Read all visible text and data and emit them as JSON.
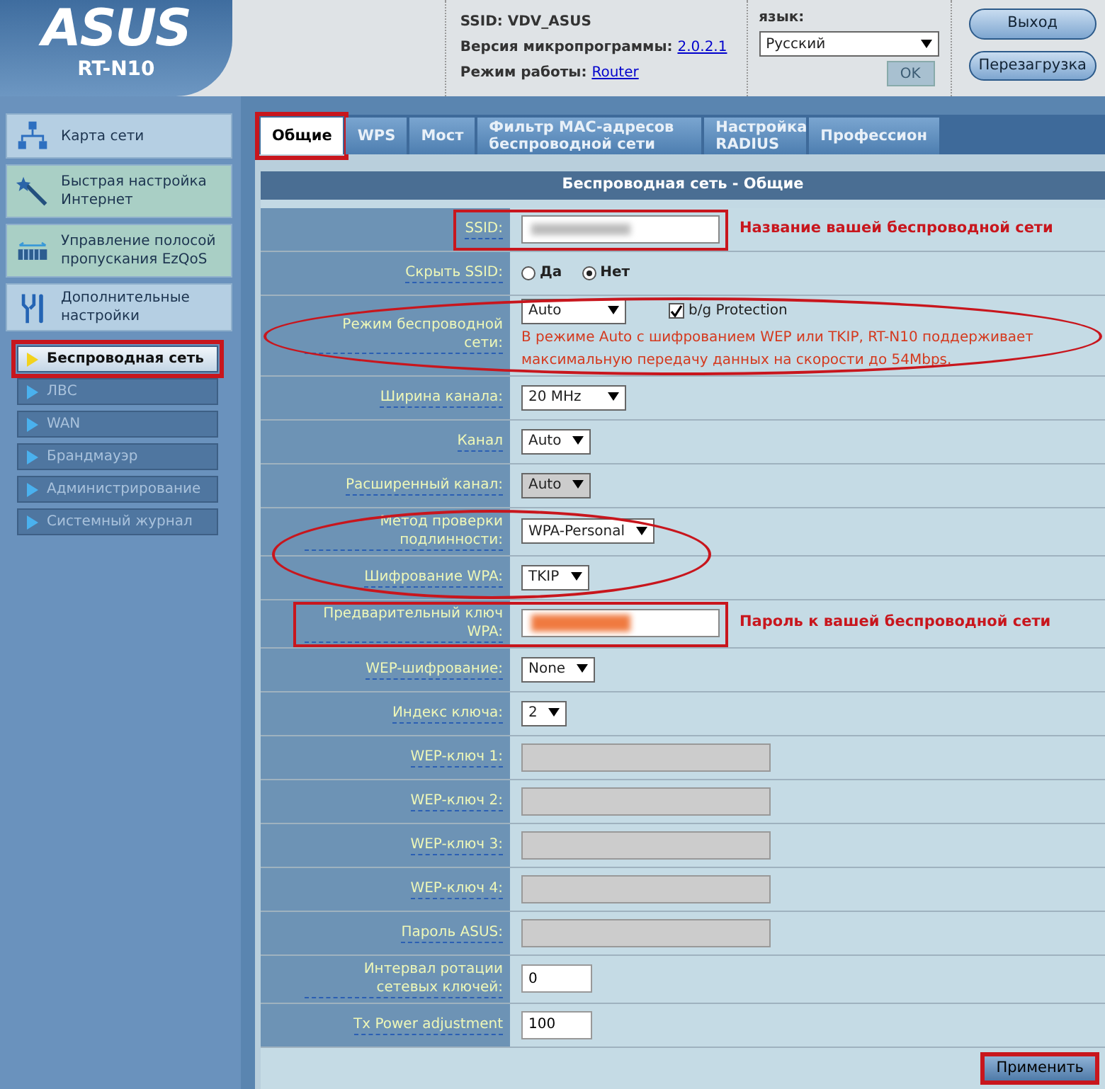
{
  "header": {
    "logo": "ASUS",
    "model": "RT-N10",
    "info": [
      {
        "label": "SSID:",
        "value": "VDV_ASUS",
        "link": false
      },
      {
        "label": "Версия микропрограммы:",
        "value": "2.0.2.1",
        "link": true
      },
      {
        "label": "Режим работы:",
        "value": "Router",
        "link": true
      }
    ],
    "language": {
      "label": "язык:",
      "value": "Русский",
      "ok": "OK",
      "ok_disabled": true
    },
    "buttons": [
      "Выход",
      "Перезагрузка"
    ]
  },
  "sidebar": {
    "items": [
      {
        "label": "Карта сети",
        "kind": "map"
      },
      {
        "label": "Быстрая настройка Интернет",
        "kind": "wand"
      },
      {
        "label": "Управление полосой пропускания EzQoS",
        "kind": "qos"
      },
      {
        "label": "Дополнительные настройки",
        "kind": "tools"
      }
    ],
    "subitems": [
      {
        "label": "Беспроводная сеть",
        "selected": true,
        "highlighted": true
      },
      {
        "label": "ЛВС",
        "selected": false,
        "highlighted": false
      },
      {
        "label": "WAN",
        "selected": false,
        "highlighted": false
      },
      {
        "label": "Брандмауэр",
        "selected": false,
        "highlighted": false
      },
      {
        "label": "Администрирование",
        "selected": false,
        "highlighted": false
      },
      {
        "label": "Системный журнал",
        "selected": false,
        "highlighted": false
      }
    ]
  },
  "tabs": [
    {
      "label": "Общие",
      "selected": true,
      "highlighted": true
    },
    {
      "label": "WPS",
      "selected": false,
      "highlighted": false
    },
    {
      "label": "Мост",
      "selected": false,
      "highlighted": false
    },
    {
      "label": "Фильтр MAC-адресов беспроводной сети",
      "selected": false,
      "highlighted": false
    },
    {
      "label": "Настройка RADIUS",
      "selected": false,
      "highlighted": false
    },
    {
      "label": "Профессион",
      "selected": false,
      "highlighted": false
    }
  ],
  "panel_title": "Беспроводная сеть - Общие",
  "rows": [
    {
      "label": "SSID:",
      "kind": "blurred",
      "boxed": true,
      "circled": false,
      "callout": "Название вашей беспроводной сети"
    },
    {
      "label": "Скрыть SSID:",
      "kind": "radio",
      "boxed": false,
      "circled": false,
      "options": [
        {
          "label": "Да",
          "selected": false
        },
        {
          "label": "Нет",
          "selected": true
        }
      ]
    },
    {
      "label": "Режим беспроводной сети:",
      "kind": "mode",
      "boxed": false,
      "circled": true,
      "value": "Auto",
      "checkbox": {
        "label": "b/g Protection",
        "checked": true
      },
      "note": "В режиме Auto с шифрованием WEP или TKIP, RT-N10 поддерживает максимальную передачу данных на скорости до 54Mbps."
    },
    {
      "label": "Ширина канала:",
      "kind": "select",
      "boxed": false,
      "circled": false,
      "value": "20 MHz",
      "disabled": false
    },
    {
      "label": "Канал",
      "kind": "select",
      "boxed": false,
      "circled": false,
      "value": "Auto",
      "disabled": false
    },
    {
      "label": "Расширенный канал:",
      "kind": "select",
      "boxed": false,
      "circled": false,
      "value": "Auto",
      "disabled": true
    },
    {
      "label": "Метод проверки подлинности:",
      "kind": "select",
      "boxed": false,
      "circled": true,
      "value": "WPA-Personal",
      "disabled": false
    },
    {
      "label": "Шифрование WPA:",
      "kind": "select",
      "boxed": false,
      "circled": true,
      "value": "TKIP",
      "disabled": false
    },
    {
      "label": "Предварительный ключ WPA:",
      "kind": "secret",
      "boxed": true,
      "circled": false,
      "callout": "Пароль к вашей беспроводной сети"
    },
    {
      "label": "WEP-шифрование:",
      "kind": "select",
      "boxed": false,
      "circled": false,
      "value": "None",
      "disabled": false
    },
    {
      "label": "Индекс ключа:",
      "kind": "select",
      "boxed": false,
      "circled": false,
      "value": "2",
      "disabled": false
    },
    {
      "label": "WEP-ключ 1:",
      "kind": "input",
      "boxed": false,
      "circled": false,
      "value": "",
      "disabled": true
    },
    {
      "label": "WEP-ключ 2:",
      "kind": "input",
      "boxed": false,
      "circled": false,
      "value": "",
      "disabled": true
    },
    {
      "label": "WEP-ключ 3:",
      "kind": "input",
      "boxed": false,
      "circled": false,
      "value": "",
      "disabled": true
    },
    {
      "label": "WEP-ключ 4:",
      "kind": "input",
      "boxed": false,
      "circled": false,
      "value": "",
      "disabled": true
    },
    {
      "label": "Пароль ASUS:",
      "kind": "input",
      "boxed": false,
      "circled": false,
      "value": "",
      "disabled": true
    },
    {
      "label": "Интервал ротации сетевых ключей:",
      "kind": "input",
      "boxed": false,
      "circled": false,
      "value": "0",
      "disabled": false
    },
    {
      "label": "Tx Power adjustment",
      "kind": "input",
      "boxed": false,
      "circled": false,
      "value": "100",
      "disabled": false
    }
  ],
  "apply": {
    "label": "Применить",
    "highlighted": true
  }
}
